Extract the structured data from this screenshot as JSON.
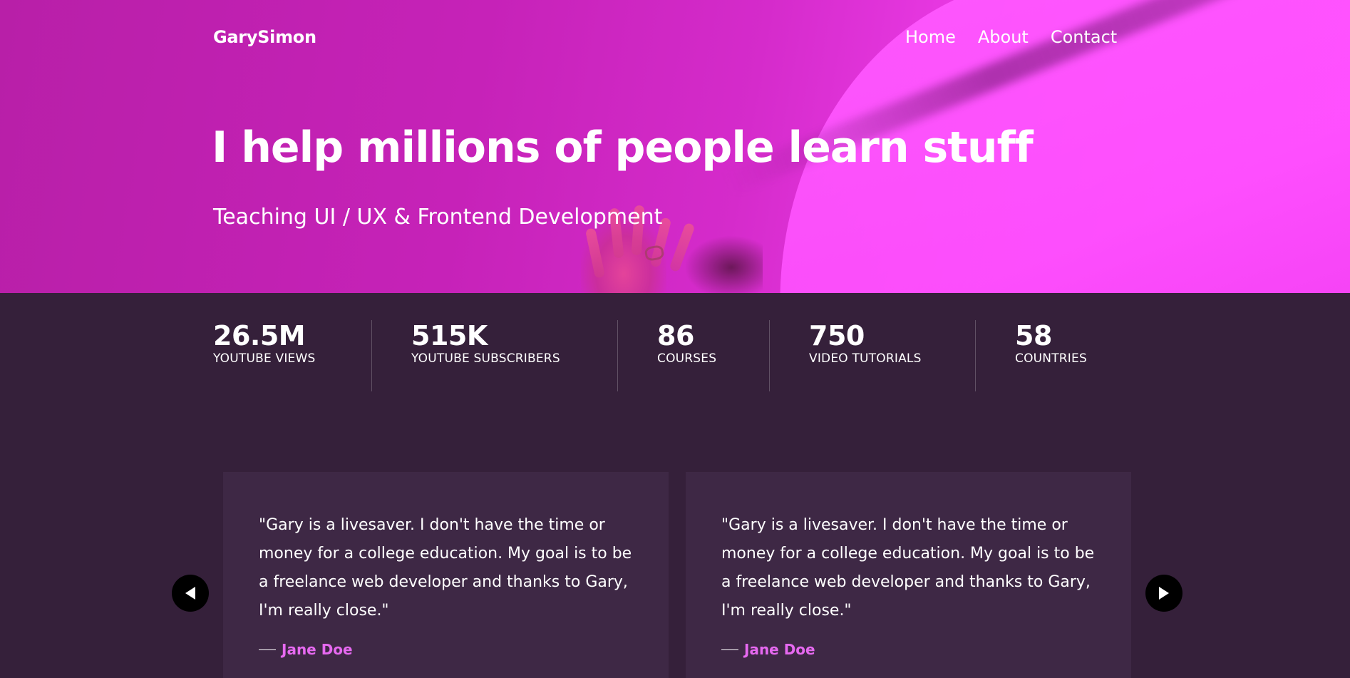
{
  "nav": {
    "logo": "GarySimon",
    "links": [
      "Home",
      "About",
      "Contact"
    ]
  },
  "hero": {
    "title": "I help millions of people learn stuff",
    "subtitle": "Teaching UI / UX & Frontend Development"
  },
  "stats": [
    {
      "value": "26.5M",
      "label": "YOUTUBE VIEWS"
    },
    {
      "value": "515K",
      "label": "YOUTUBE SUBSCRIBERS"
    },
    {
      "value": "86",
      "label": "COURSES"
    },
    {
      "value": "750",
      "label": "VIDEO TUTORIALS"
    },
    {
      "value": "58",
      "label": "COUNTRIES"
    }
  ],
  "testimonials": [
    {
      "quote": "\"Gary is a livesaver. I don't have the time or money for a college education. My goal is to be a freelance web developer and thanks to Gary, I'm really close.\"",
      "author": "Jane Doe"
    },
    {
      "quote": "\"Gary is a livesaver. I don't have the time or money for a college education. My goal is to be a freelance web developer and thanks to Gary, I'm really close.\"",
      "author": "Jane Doe"
    }
  ],
  "colors": {
    "hero_gradient_start": "#b81fa8",
    "hero_gradient_end": "#ff4bff",
    "page_background": "#35203a",
    "card_background": "#3e2845",
    "author_accent": "#e669f0"
  },
  "icons": {
    "prev": "triangle-left-icon",
    "next": "triangle-right-icon"
  }
}
